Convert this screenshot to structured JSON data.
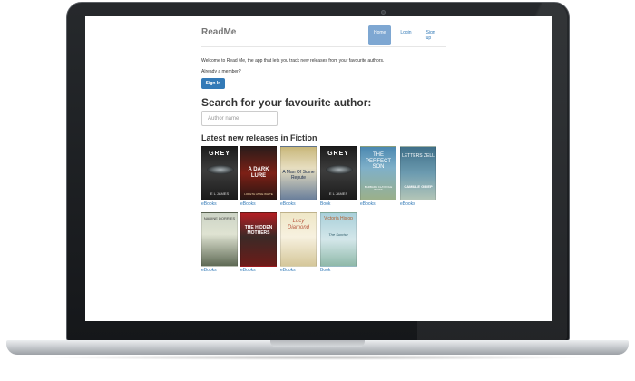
{
  "nav": {
    "brand": "ReadMe",
    "links": [
      "Home",
      "Login",
      "Sign up"
    ]
  },
  "welcome": {
    "message": "Welcome to Read Me, the app that lets you track new releases from your favourite authors.",
    "already_member": "Already a member?",
    "sign_in": "Sign In"
  },
  "search": {
    "title": "Search for your favourite author:",
    "placeholder": "Author name"
  },
  "latest": {
    "title": "Latest new releases in Fiction",
    "books": [
      {
        "cover_title": "GREY",
        "cover_author": "E L JAMES",
        "format": "eBooks"
      },
      {
        "cover_title": "A DARK LURE",
        "cover_author": "LORETH ANNE WHITE",
        "format": "eBooks"
      },
      {
        "cover_title": "A Man Of Some Repute",
        "cover_author": "",
        "format": "eBooks"
      },
      {
        "cover_title": "GREY",
        "cover_author": "E L JAMES",
        "format": "Book"
      },
      {
        "cover_title": "THE PERFECT SON",
        "cover_author": "BARBARA CLAYPOLE WHITE",
        "format": "eBooks"
      },
      {
        "cover_title": "LETTERS ZELL",
        "cover_author": "CAMILLE GRIEP",
        "format": "eBooks"
      },
      {
        "cover_title": "NADINE DORRIES",
        "cover_author": "",
        "format": "eBooks"
      },
      {
        "cover_title": "THE HIDDEN MOTHERS",
        "cover_author": "",
        "format": "eBooks"
      },
      {
        "cover_title": "Lucy Diamond",
        "cover_author": "",
        "format": "eBooks"
      },
      {
        "cover_title": "Victoria Hislop",
        "cover_author": "The Sunrise",
        "format": "Book"
      }
    ]
  }
}
